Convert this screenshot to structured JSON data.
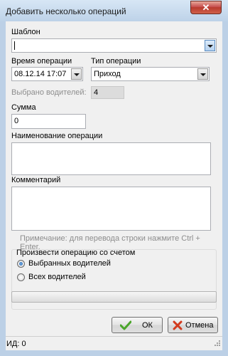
{
  "window": {
    "title": "Добавить несколько операций",
    "close_glyph": "✕"
  },
  "template": {
    "label": "Шаблон",
    "value": ""
  },
  "op_time": {
    "label": "Время операции",
    "value": "08.12.14 17:07"
  },
  "op_type": {
    "label": "Тип операции",
    "value": "Приход"
  },
  "drivers_selected": {
    "label": "Выбрано водителей:",
    "value": "4"
  },
  "sum": {
    "label": "Сумма",
    "value": "0"
  },
  "op_name": {
    "label": "Наименование операции",
    "value": ""
  },
  "comment": {
    "label": "Комментарий",
    "value": ""
  },
  "note": "Примечание: для перевода строки нажмите Ctrl + Enter.",
  "account_group": {
    "title": "Произвести операцию со счетом",
    "options": [
      {
        "label": "Выбранных водителей",
        "selected": true
      },
      {
        "label": "Всех водителей",
        "selected": false
      }
    ]
  },
  "progress": {
    "value": 0
  },
  "buttons": {
    "ok": "ОК",
    "cancel": "Отмена"
  },
  "status": {
    "id_text": "ИД: 0"
  },
  "colors": {
    "accent": "#3d7bc9",
    "ok_icon": "#4aa52a",
    "cancel_icon": "#d23a1d"
  }
}
